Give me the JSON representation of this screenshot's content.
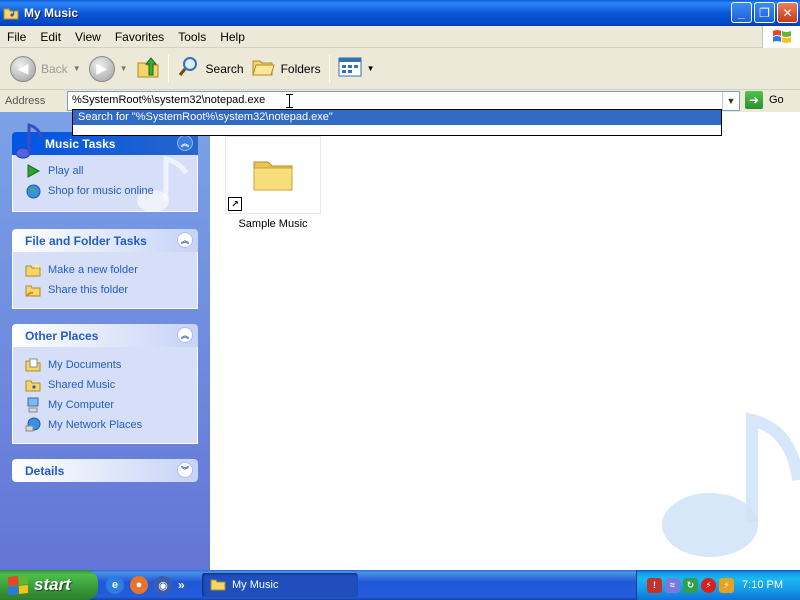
{
  "window": {
    "title": "My Music"
  },
  "menu": [
    "File",
    "Edit",
    "View",
    "Favorites",
    "Tools",
    "Help"
  ],
  "toolbar": {
    "back": "Back",
    "search": "Search",
    "folders": "Folders"
  },
  "address": {
    "label": "Address",
    "value": "%SystemRoot%\\system32\\notepad.exe",
    "go": "Go",
    "suggestion": "Search for \"%SystemRoot%\\system32\\notepad.exe\""
  },
  "panels": {
    "music_tasks": {
      "title": "Music Tasks",
      "items": [
        "Play all",
        "Shop for music online"
      ]
    },
    "file_tasks": {
      "title": "File and Folder Tasks",
      "items": [
        "Make a new folder",
        "Share this folder"
      ]
    },
    "other_places": {
      "title": "Other Places",
      "items": [
        "My Documents",
        "Shared Music",
        "My Computer",
        "My Network Places"
      ]
    },
    "details": {
      "title": "Details"
    }
  },
  "files": [
    {
      "name": "Sample Music"
    }
  ],
  "taskbar": {
    "start": "start",
    "task": "My Music",
    "clock": "7:10 PM"
  },
  "colors": {
    "titlebar": "#0a58d6",
    "panel_link": "#215dc6",
    "selection": "#316ac5",
    "start": "#3a9a3a"
  }
}
